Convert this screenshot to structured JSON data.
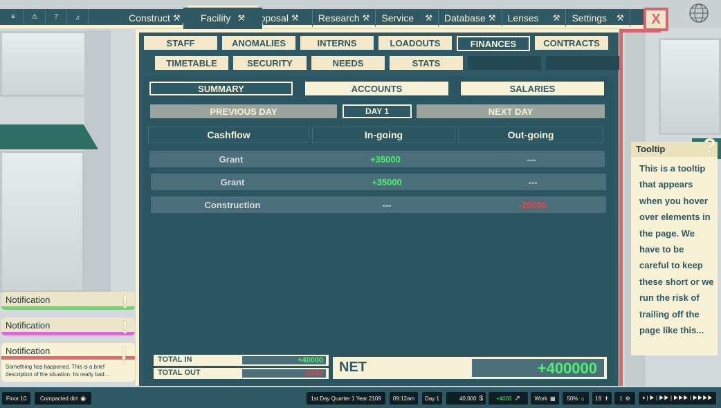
{
  "quick_icons": [
    {
      "name": "menu-icon",
      "glyph": "≡"
    },
    {
      "name": "warning-icon",
      "glyph": "⚠"
    },
    {
      "name": "help-icon",
      "glyph": "?"
    },
    {
      "name": "bell-icon",
      "glyph": "🔔"
    }
  ],
  "nav_tabs": [
    {
      "label": "Construct",
      "icon": "⚒"
    },
    {
      "label": "Facility",
      "icon": "⚒"
    },
    {
      "label": "Proposal",
      "icon": "⚒"
    },
    {
      "label": "Research",
      "icon": "⚒"
    },
    {
      "label": "Service",
      "icon": "⚒"
    },
    {
      "label": "Database",
      "icon": "⚒"
    },
    {
      "label": "Lenses",
      "icon": "⚒"
    },
    {
      "label": "Settings",
      "icon": "⚒"
    }
  ],
  "close_label": "X",
  "subtabs_row1": [
    "STAFF",
    "ANOMALIES",
    "INTERNS",
    "LOADOUTS",
    "FINANCES",
    "CONTRACTS"
  ],
  "subtabs_row2": [
    "TIMETABLE",
    "SECURITY",
    "NEEDS",
    "STATS",
    "",
    ""
  ],
  "active_subtab": "FINANCES",
  "view_buttons": [
    "SUMMARY",
    "ACCOUNTS",
    "SALARIES"
  ],
  "active_view": "SUMMARY",
  "day_nav": {
    "prev": "PREVIOUS DAY",
    "current": "DAY 1",
    "next": "NEXT DAY"
  },
  "table": {
    "headers": [
      "Cashflow",
      "In-going",
      "Out-going"
    ],
    "rows": [
      {
        "name": "Grant",
        "in": "+35000",
        "out": "---"
      },
      {
        "name": "Grant",
        "in": "+35000",
        "out": "---"
      },
      {
        "name": "Construction",
        "in": "---",
        "out": "-20000"
      }
    ]
  },
  "totals": {
    "in_label": "TOTAL IN",
    "in_value": "+40000",
    "out_label": "TOTAL OUT",
    "out_value": "-2343",
    "net_label": "NET",
    "net_value": "+400000"
  },
  "tooltip": {
    "title": "Tooltip",
    "body": "This is a tooltip that appears when you hover over elements in the page. We have to be careful to keep these short or we run the risk of trailing off the page like this..."
  },
  "notifications": [
    {
      "title": "Notification",
      "color": "#6ad86a"
    },
    {
      "title": "Notification",
      "color": "#d86ad8"
    }
  ],
  "notification_expanded": {
    "title": "Notification",
    "color": "#e06a6f",
    "description": "Something has happened.  This is a brief description of the situation. Its really bad..."
  },
  "status": {
    "floor": "Floor 10",
    "terrain": "Compacted dirt",
    "date": "1st Day Quarter 1 Year 2109",
    "time": "09:12am",
    "day": "Day 1",
    "money": "40,000",
    "money_icon": "$",
    "income": "+4000",
    "mode": "Work",
    "efficiency": "50%",
    "staff_count": "19",
    "alerts": "1",
    "speed_controls": "⏸ | ▶ | ▶▶ | ▶▶▶ | ▶▶▶▶"
  },
  "colors": {
    "panel": "#2f5964",
    "cream": "#f7f1d6",
    "positive": "#4cf069",
    "negative": "#e8444a",
    "accent_red": "#d9646f"
  }
}
